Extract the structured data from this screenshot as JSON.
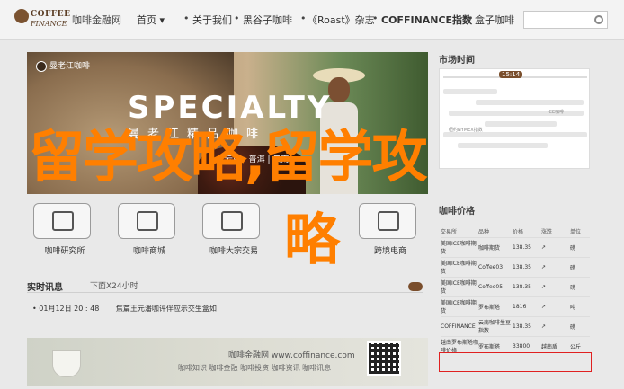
{
  "topbar": {
    "brand_line1": "COFFEE",
    "brand_line2": "FINANCE",
    "site_name": "咖啡金融网",
    "nav": [
      {
        "label": "首页",
        "has_caret": true,
        "bold": false
      },
      {
        "label": "关于我们",
        "bold": false
      },
      {
        "label": "黑谷子咖啡",
        "bold": false
      },
      {
        "label": "《Roast》杂志",
        "bold": false
      },
      {
        "label": "COFFINANCE指数",
        "bold": true
      },
      {
        "label": "盒子咖啡",
        "bold": false
      }
    ],
    "caret": "▾",
    "separator": "•",
    "search_placeholder": ""
  },
  "banner": {
    "logo_text": "曼老江咖啡",
    "headline": "SPECIALTY",
    "subline": "曼老江精品咖啡",
    "place": "云南 · 普洱 | 云南"
  },
  "overlay": {
    "line1": "留学攻略,留学攻",
    "line2": "略"
  },
  "tiles": [
    {
      "label": "咖啡研究所",
      "icon": "book-icon"
    },
    {
      "label": "咖啡商城",
      "icon": "cart-icon"
    },
    {
      "label": "咖啡大宗交易",
      "icon": "beans-icon"
    },
    {
      "label": "跨境电商",
      "icon": "ship-icon"
    }
  ],
  "news": {
    "title": "实时讯息",
    "subtitle": "下面X24小时",
    "item_time": "• 01月12日 20 : 48",
    "item_text": "焦篇王元潘咖评伴应示交生盒如"
  },
  "footer": {
    "title": "咖啡金融网 www.coffinance.com",
    "links": "咖啡知识 咖啡金融 咖啡投资 咖啡资讯 咖啡讯息"
  },
  "timeline": {
    "title": "市场时间",
    "marker": "15:14",
    "labels": [
      "亚洲期货",
      "欧洲期货",
      "美国期货",
      "伦敦期货",
      "ICE咖啡",
      "纽约NYMEX指数"
    ]
  },
  "prices": {
    "title": "咖啡价格",
    "headers": [
      "交易所",
      "品种",
      "价格",
      "涨跌",
      "单位"
    ],
    "rows": [
      [
        "美国ICE咖啡期货",
        "咖啡期货",
        "138.35",
        "↗",
        "磅"
      ],
      [
        "美国ICE咖啡期货",
        "Coffee03",
        "138.35",
        "↗",
        "磅"
      ],
      [
        "美国ICE咖啡期货",
        "Coffee05",
        "138.35",
        "↗",
        "磅"
      ],
      [
        "美国ICE咖啡期货",
        "罗布斯塔",
        "1816",
        "↗",
        "吨"
      ],
      [
        "COFFINANCE",
        "云南咖啡生豆指数",
        "138.35",
        "↗",
        "磅"
      ],
      [
        "越南罗布斯塔咖啡价格",
        "罗布斯塔",
        "33800",
        "越南盾",
        "公斤"
      ]
    ]
  },
  "colors": {
    "accent": "#7a4e2c",
    "overlay": "#ff7f00",
    "highlight": "#e02020"
  }
}
